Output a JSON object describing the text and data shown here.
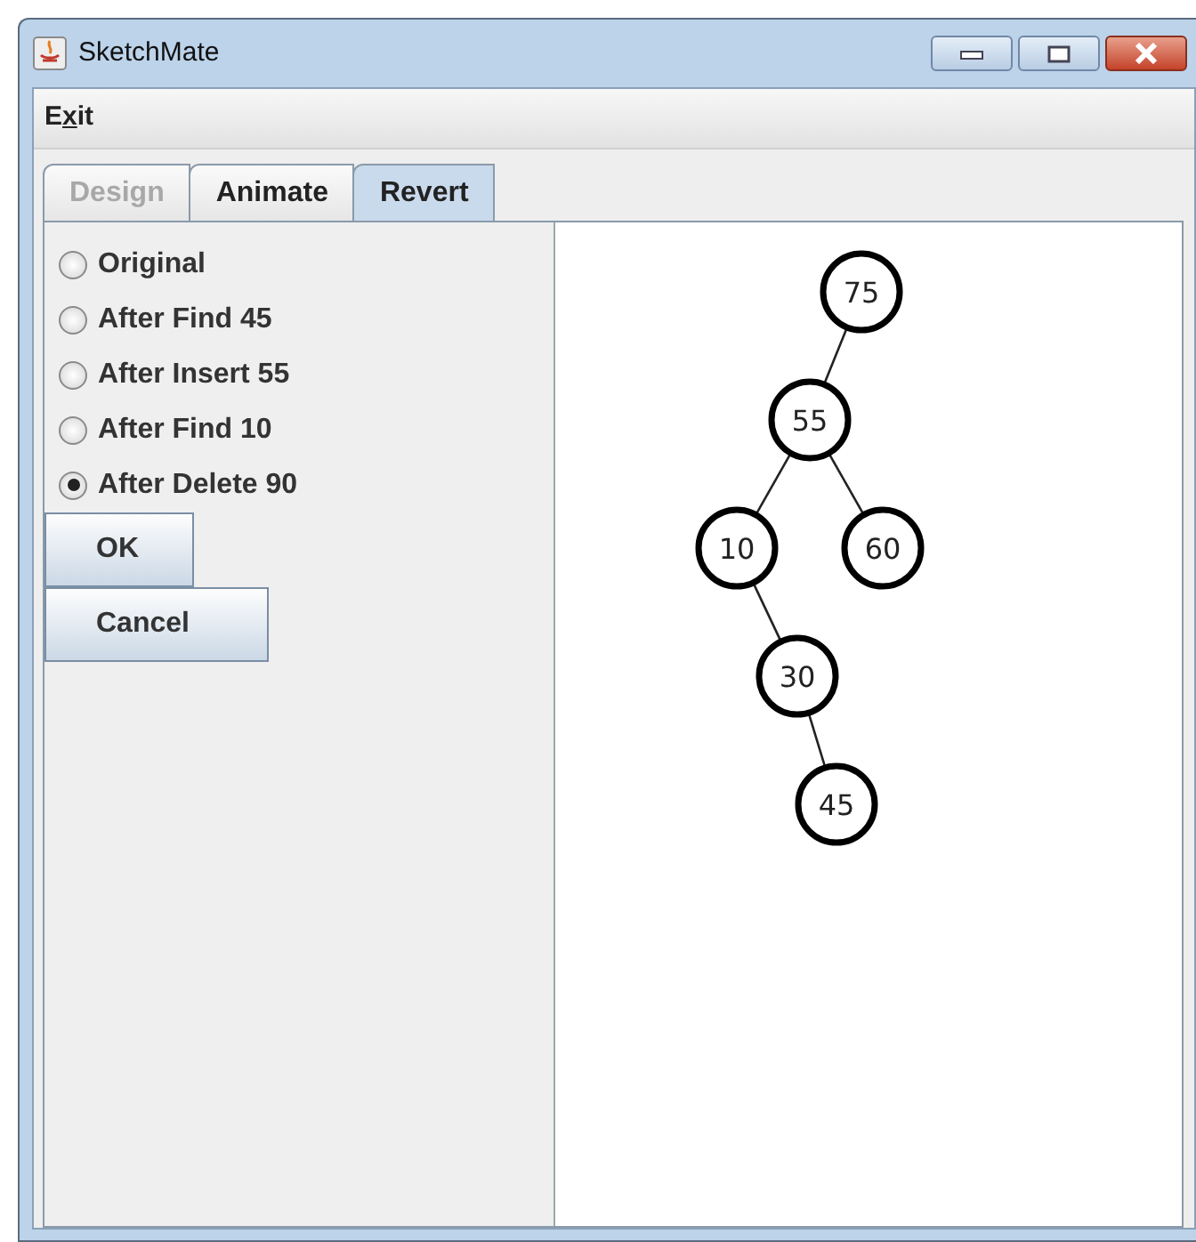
{
  "window": {
    "title": "SketchMate"
  },
  "menu": [
    {
      "label": "Exit",
      "mnemonic_shown": true
    }
  ],
  "tabs": [
    {
      "label": "Design",
      "selected": false,
      "disabled": true
    },
    {
      "label": "Animate",
      "selected": false,
      "disabled": false
    },
    {
      "label": "Revert",
      "selected": true,
      "disabled": false
    }
  ],
  "options": [
    {
      "label": "Original",
      "selected": false
    },
    {
      "label": "After Find 45",
      "selected": false
    },
    {
      "label": "After Insert 55",
      "selected": false
    },
    {
      "label": "After Find 10",
      "selected": false
    },
    {
      "label": "After Delete 90",
      "selected": true
    }
  ],
  "buttons": [
    "OK",
    "Cancel"
  ],
  "tree": {
    "value": "75",
    "children": [
      {
        "value": "55",
        "kind": "left",
        "children": [
          {
            "value": "10",
            "kind": "left",
            "children": [
              {
                "value": "30",
                "kind": "right",
                "children": [
                  {
                    "value": "45",
                    "kind": "right"
                  }
                ]
              }
            ]
          },
          {
            "value": "60",
            "kind": "right"
          }
        ]
      }
    ]
  }
}
